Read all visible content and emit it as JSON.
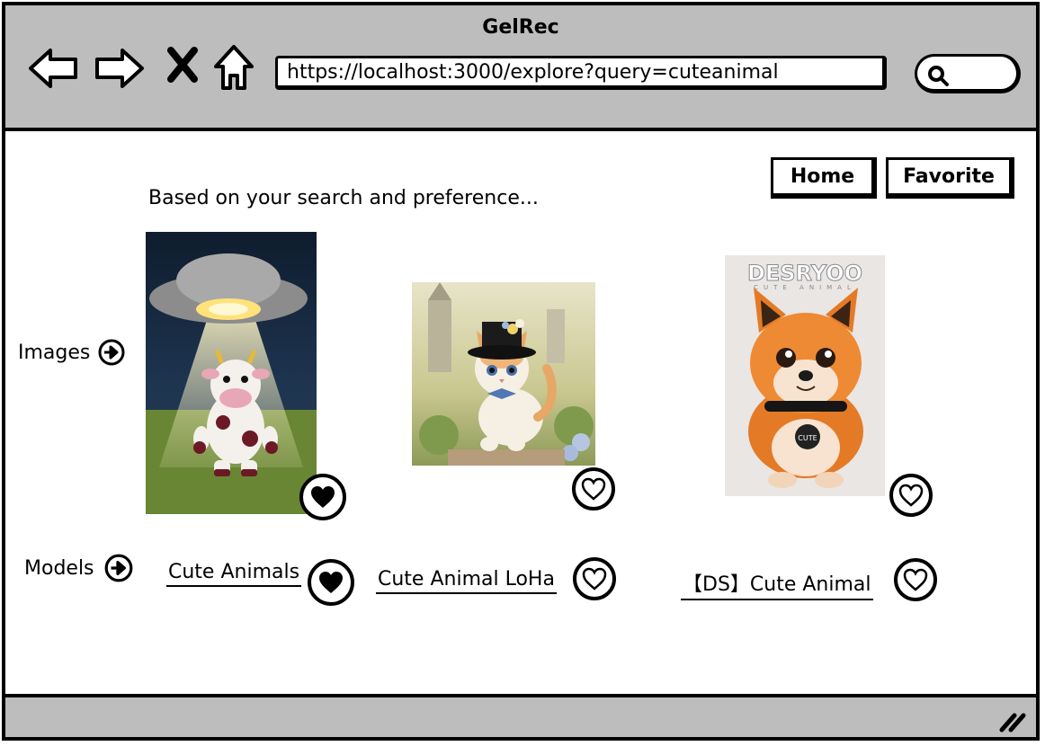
{
  "window": {
    "title": "GelRec"
  },
  "browser": {
    "url": "https://localhost:3000/explore?query=cuteanimal",
    "icons": [
      "back-arrow-icon",
      "forward-arrow-icon",
      "close-x-icon",
      "home-icon",
      "search-icon"
    ]
  },
  "nav": {
    "home_label": "Home",
    "favorite_label": "Favorite"
  },
  "main": {
    "subtitle": "Based on your search and preference...",
    "images_label": "Images",
    "models_label": "Models"
  },
  "images": [
    {
      "subject": "crocheted cow under UFO",
      "favorited": true
    },
    {
      "subject": "kitten with top hat and bow tie",
      "favorited": false
    },
    {
      "subject": "fluffy orange fox",
      "favorited": false,
      "poster_text": "DESRYOO",
      "poster_subtext": "CUTE ANIMAL",
      "tag_text": "CUTE"
    }
  ],
  "models": [
    {
      "name": "Cute Animals",
      "favorited": true
    },
    {
      "name": "Cute Animal LoHa",
      "favorited": false
    },
    {
      "name": "【DS】Cute Animal",
      "favorited": false
    }
  ]
}
